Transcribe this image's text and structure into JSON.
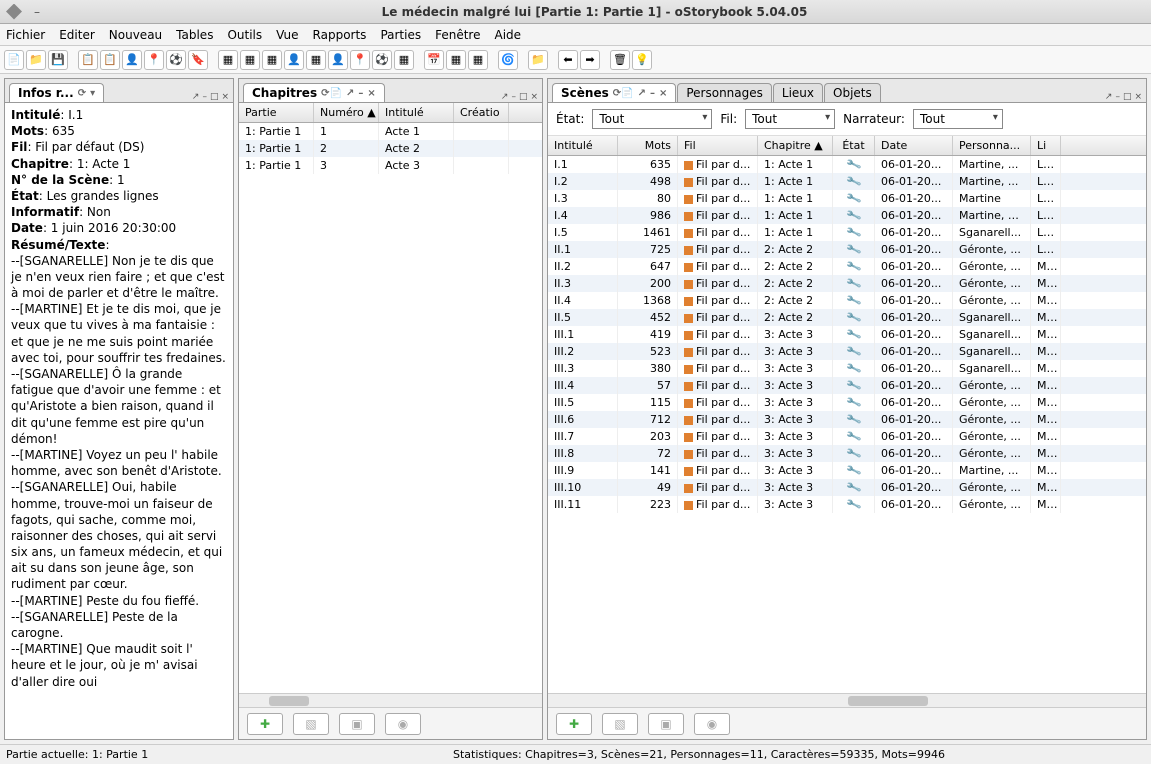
{
  "window": {
    "title": "Le médecin malgré lui [Partie 1: Partie 1] - oStorybook 5.04.05"
  },
  "menu": [
    "Fichier",
    "Editer",
    "Nouveau",
    "Tables",
    "Outils",
    "Vue",
    "Rapports",
    "Parties",
    "Fenêtre",
    "Aide"
  ],
  "info_panel": {
    "title": "Infos r...",
    "fields": {
      "intitule_lbl": "Intitulé",
      "intitule": "I.1",
      "mots_lbl": "Mots",
      "mots": "635",
      "fil_lbl": "Fil",
      "fil": "Fil par défaut (DS)",
      "chapitre_lbl": "Chapitre",
      "chapitre": "1: Acte 1",
      "numscene_lbl": "N° de la Scène",
      "numscene": "1",
      "etat_lbl": "État",
      "etat": "Les grandes lignes",
      "informatif_lbl": "Informatif",
      "informatif": "Non",
      "date_lbl": "Date",
      "date": "1 juin 2016 20:30:00",
      "resume_lbl": "Résumé/Texte"
    },
    "resume": "--[SGANARELLE] Non je te dis que je n'en veux rien faire ; et que c'est à moi de parler et d'être le maître.\n--[MARTINE] Et je te dis moi, que je veux que tu vives à ma fantaisie : et que je ne me suis point mariée avec toi, pour souffrir tes fredaines.\n--[SGANARELLE] Ô la grande fatigue que d'avoir une femme : et qu'Aristote a bien raison, quand il dit qu'une femme est pire qu'un démon!\n--[MARTINE] Voyez un peu l' habile homme, avec son benêt d'Aristote.\n--[SGANARELLE] Oui, habile homme, trouve-moi un faiseur de fagots, qui sache, comme moi, raisonner des choses, qui ait servi six ans, un fameux médecin, et qui ait su dans son jeune âge, son rudiment par cœur.\n--[MARTINE] Peste du fou fieffé.\n--[SGANARELLE] Peste de la carogne.\n--[MARTINE] Que maudit soit l' heure et le jour, où je m' avisai d'aller dire oui"
  },
  "chapitres": {
    "title": "Chapitres",
    "headers": {
      "partie": "Partie",
      "numero": "Numéro ▲",
      "intitule": "Intitulé",
      "creation": "Créatio"
    },
    "rows": [
      {
        "partie": "1: Partie 1",
        "num": "1",
        "int": "Acte 1"
      },
      {
        "partie": "1: Partie 1",
        "num": "2",
        "int": "Acte 2"
      },
      {
        "partie": "1: Partie 1",
        "num": "3",
        "int": "Acte 3"
      }
    ]
  },
  "scenes": {
    "title": "Scènes",
    "tabs": {
      "personnages": "Personnages",
      "lieux": "Lieux",
      "objets": "Objets"
    },
    "filters": {
      "etat_lbl": "État:",
      "etat": "Tout",
      "fil_lbl": "Fil:",
      "fil": "Tout",
      "narr_lbl": "Narrateur:",
      "narr": "Tout"
    },
    "headers": {
      "intitule": "Intitulé",
      "mots": "Mots",
      "fil": "Fil",
      "chapitre": "Chapitre ▲",
      "etat": "État",
      "date": "Date",
      "pers": "Personna...",
      "li": "Li"
    },
    "rows": [
      {
        "int": "I.1",
        "mots": "635",
        "fil": "Fil par d...",
        "chap": "1: Acte 1",
        "date": "06-01-20...",
        "pers": "Martine, ...",
        "li": "La c"
      },
      {
        "int": "I.2",
        "mots": "498",
        "fil": "Fil par d...",
        "chap": "1: Acte 1",
        "date": "06-01-20...",
        "pers": "Martine, ...",
        "li": "La c"
      },
      {
        "int": "I.3",
        "mots": "80",
        "fil": "Fil par d...",
        "chap": "1: Acte 1",
        "date": "06-01-20...",
        "pers": "Martine",
        "li": "La c"
      },
      {
        "int": "I.4",
        "mots": "986",
        "fil": "Fil par d...",
        "chap": "1: Acte 1",
        "date": "06-01-20...",
        "pers": "Martine, L...",
        "li": "La c"
      },
      {
        "int": "I.5",
        "mots": "1461",
        "fil": "Fil par d...",
        "chap": "1: Acte 1",
        "date": "06-01-20...",
        "pers": "Sganarell...",
        "li": "La c"
      },
      {
        "int": "II.1",
        "mots": "725",
        "fil": "Fil par d...",
        "chap": "2: Acte 2",
        "date": "06-01-20...",
        "pers": "Géronte, ...",
        "li": "La c"
      },
      {
        "int": "II.2",
        "mots": "647",
        "fil": "Fil par d...",
        "chap": "2: Acte 2",
        "date": "06-01-20...",
        "pers": "Géronte, ...",
        "li": "Mais"
      },
      {
        "int": "II.3",
        "mots": "200",
        "fil": "Fil par d...",
        "chap": "2: Acte 2",
        "date": "06-01-20...",
        "pers": "Géronte, ...",
        "li": "Mais"
      },
      {
        "int": "II.4",
        "mots": "1368",
        "fil": "Fil par d...",
        "chap": "2: Acte 2",
        "date": "06-01-20...",
        "pers": "Géronte, ...",
        "li": "Mais"
      },
      {
        "int": "II.5",
        "mots": "452",
        "fil": "Fil par d...",
        "chap": "2: Acte 2",
        "date": "06-01-20...",
        "pers": "Sganarell...",
        "li": "Mais"
      },
      {
        "int": "III.1",
        "mots": "419",
        "fil": "Fil par d...",
        "chap": "3: Acte 3",
        "date": "06-01-20...",
        "pers": "Sganarell...",
        "li": "Mais"
      },
      {
        "int": "III.2",
        "mots": "523",
        "fil": "Fil par d...",
        "chap": "3: Acte 3",
        "date": "06-01-20...",
        "pers": "Sganarell...",
        "li": "Mais"
      },
      {
        "int": "III.3",
        "mots": "380",
        "fil": "Fil par d...",
        "chap": "3: Acte 3",
        "date": "06-01-20...",
        "pers": "Sganarell...",
        "li": "Mais"
      },
      {
        "int": "III.4",
        "mots": "57",
        "fil": "Fil par d...",
        "chap": "3: Acte 3",
        "date": "06-01-20...",
        "pers": "Géronte, ...",
        "li": "Mais"
      },
      {
        "int": "III.5",
        "mots": "115",
        "fil": "Fil par d...",
        "chap": "3: Acte 3",
        "date": "06-01-20...",
        "pers": "Géronte, ...",
        "li": "Mais"
      },
      {
        "int": "III.6",
        "mots": "712",
        "fil": "Fil par d...",
        "chap": "3: Acte 3",
        "date": "06-01-20...",
        "pers": "Géronte, ...",
        "li": "Mais"
      },
      {
        "int": "III.7",
        "mots": "203",
        "fil": "Fil par d...",
        "chap": "3: Acte 3",
        "date": "06-01-20...",
        "pers": "Géronte, ...",
        "li": "Mais"
      },
      {
        "int": "III.8",
        "mots": "72",
        "fil": "Fil par d...",
        "chap": "3: Acte 3",
        "date": "06-01-20...",
        "pers": "Géronte, ...",
        "li": "Mais"
      },
      {
        "int": "III.9",
        "mots": "141",
        "fil": "Fil par d...",
        "chap": "3: Acte 3",
        "date": "06-01-20...",
        "pers": "Martine, ...",
        "li": "Mais"
      },
      {
        "int": "III.10",
        "mots": "49",
        "fil": "Fil par d...",
        "chap": "3: Acte 3",
        "date": "06-01-20...",
        "pers": "Géronte, ...",
        "li": "Mais"
      },
      {
        "int": "III.11",
        "mots": "223",
        "fil": "Fil par d...",
        "chap": "3: Acte 3",
        "date": "06-01-20...",
        "pers": "Géronte, ...",
        "li": "Mais"
      }
    ]
  },
  "status": {
    "partie": "Partie actuelle: 1: Partie 1",
    "stats": "Statistiques: Chapitres=3,  Scènes=21,  Personnages=11,  Caractères=59335,  Mots=9946"
  }
}
